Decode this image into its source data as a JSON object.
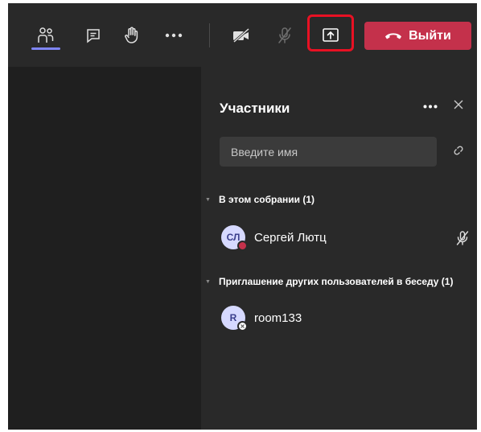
{
  "toolbar": {
    "icons": {
      "participants": "participants-icon",
      "chat": "chat-icon",
      "raise_hand": "raise-hand-icon",
      "more": "more-options-icon",
      "camera": "camera-off-icon",
      "mic": "mic-off-icon",
      "share": "share-screen-icon"
    },
    "leave": {
      "label": "Выйти",
      "icon": "hang-up-icon",
      "color": "#c4314b"
    },
    "highlight_color": "#e81123",
    "active_underline_color": "#7f85f5"
  },
  "panel": {
    "title": "Участники",
    "search_placeholder": "Введите имя",
    "sections": [
      {
        "title": "В этом собрании (1)",
        "people": [
          {
            "initials": "СЛ",
            "name": "Сергей Лютц",
            "status": "busy",
            "muted": true
          }
        ]
      },
      {
        "title": "Приглашение других пользователей в беседу (1)",
        "people": [
          {
            "initials": "R",
            "name": "room133",
            "status": "offline",
            "muted": false
          }
        ]
      }
    ]
  },
  "colors": {
    "toolbar_bg": "#292929",
    "stage_bg": "#1f1f1f",
    "panel_bg": "#292929",
    "avatar_bg": "#d6d9ff",
    "busy": "#c4314b"
  }
}
